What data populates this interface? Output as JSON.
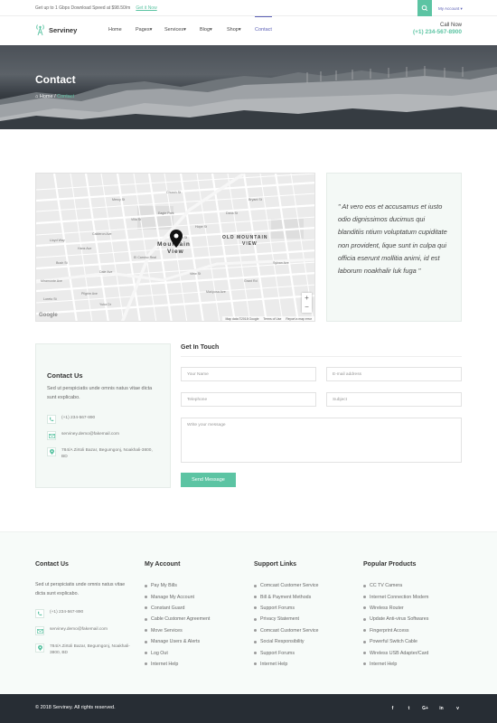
{
  "topbar": {
    "promo": "Get up to 1 Gbps Download Speed at $98.50/m",
    "promo_link": "Get it Now",
    "account": "My Account"
  },
  "header": {
    "logo": "Serviney",
    "nav": [
      {
        "label": "Home",
        "dropdown": false
      },
      {
        "label": "Pages",
        "dropdown": true
      },
      {
        "label": "Services",
        "dropdown": true
      },
      {
        "label": "Blog",
        "dropdown": true
      },
      {
        "label": "Shop",
        "dropdown": true
      },
      {
        "label": "Contact",
        "dropdown": false
      }
    ],
    "call_label": "Call Now",
    "call_number": "(+1) 234-567-8900"
  },
  "hero": {
    "title": "Contact",
    "breadcrumb_home": "Home",
    "breadcrumb_current": "Contact"
  },
  "map": {
    "place_label_1": "Mountain",
    "place_label_2": "View",
    "area_label_1": "OLD MOUNTAIN",
    "area_label_2": "VIEW",
    "streets": [
      "Eagle Park",
      "Mercy St",
      "Church St",
      "Villa St",
      "Hope St",
      "Dana St",
      "Bryant St",
      "View St",
      "Castro St",
      "El Camino Real",
      "Calderon Ave",
      "Hans Ave",
      "Miramonte Ave",
      "Dale Ave",
      "Pilgrim Ave",
      "Yuba Dr",
      "Loreto St",
      "Lloyd Way",
      "Bush St",
      "Grant Rd",
      "Sylvan Ave",
      "Mariposa Ave"
    ],
    "attribution": "Map data ©2018 Google",
    "terms": "Terms of Use",
    "report": "Report a map error",
    "google": "Google"
  },
  "quote": "\" At vero eos et accusamus et iusto odio dignissimos ducimus qui blanditiis ntium voluptatum cupiditate non provident, lique sunt in culpa qui officia eserunt mollitia animi, id est laborum noakhalir luk fuga \"",
  "contact_us": {
    "title": "Contact Us",
    "text": "Sed ut perspiciatis unde omnis natus vitae dicta sunt explicabo.",
    "phone": "(+1) 234-567-890",
    "email": "serviney.demo@fakemail.com",
    "address": "784/A Zirtoli Bazar, Begumgonj, Noakhali-3800, BD"
  },
  "form": {
    "title": "Get In Touch",
    "name_placeholder": "Your Name",
    "email_placeholder": "E-mail address",
    "phone_placeholder": "Telephone",
    "subject_placeholder": "Subject",
    "message_placeholder": "Write your message",
    "submit": "Send Message"
  },
  "footer": {
    "col1": {
      "title": "Contact Us",
      "text": "Sed ut perspiciatis unde omnis natus vitae dicta sunt explicabo.",
      "phone": "(+1) 234-567-890",
      "email": "serviney.demo@fakemail.com",
      "address": "784/A Zirtoli Bazar, Begumgonj, Noakhali-3800, BD"
    },
    "col2": {
      "title": "My Account",
      "items": [
        "Pay My Bills",
        "Manage My Account",
        "Constant Guard",
        "Cable Customer Agreement",
        "Move Services",
        "Manage Users & Alerts",
        "Log Out",
        "Internet Help"
      ]
    },
    "col3": {
      "title": "Support Links",
      "items": [
        "Comcast Customer Service",
        "Bill & Payment Methods",
        "Support Forums",
        "Privacy Statement",
        "Comcast Customer Service",
        "Social Responsibility",
        "Support Forums",
        "Internet Help"
      ]
    },
    "col4": {
      "title": "Popular Products",
      "items": [
        "CC TV Camera",
        "Internet Connection Modem",
        "Wireless Router",
        "Update Anti-virus Softwares",
        "Fingerprint Access",
        "Powerful Switch Cable",
        "Wireless USB Adapter/Card",
        "Internet Help"
      ]
    }
  },
  "copyright": "© 2018 Serviney. All rights reserved.",
  "social": [
    "f",
    "t",
    "G+",
    "in",
    "v"
  ],
  "colors": {
    "accent": "#5cc4a3",
    "nav_active": "#5b5fb5",
    "dark": "#272d34"
  }
}
